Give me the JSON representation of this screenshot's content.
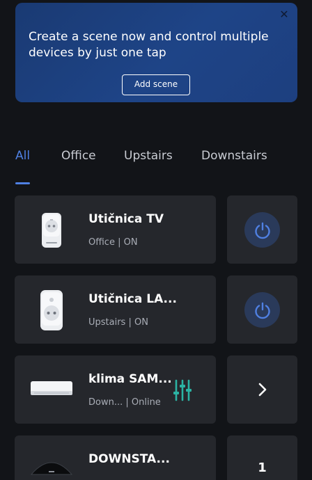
{
  "banner": {
    "text": "Create a scene now and control multiple devices by just one tap",
    "button_label": "Add scene",
    "close_icon": "close-icon"
  },
  "tabs": [
    {
      "label": "All",
      "active": true
    },
    {
      "label": "Office",
      "active": false
    },
    {
      "label": "Upstairs",
      "active": false
    },
    {
      "label": "Downstairs",
      "active": false
    }
  ],
  "devices": [
    {
      "name": "Utičnica TV",
      "status": "Office | ON",
      "icon": "smart-plug-icon",
      "action": "power-button"
    },
    {
      "name": "Utičnica LA...",
      "status": "Upstairs | ON",
      "icon": "smart-plug-icon",
      "action": "power-button"
    },
    {
      "name": "klima SAM...",
      "status": "Down... | Online",
      "icon": "air-conditioner-icon",
      "extra_icon": "sliders-icon",
      "action": "chevron-right-icon"
    },
    {
      "name": "DOWNSTA...",
      "status": "",
      "icon": "ir-hub-icon",
      "action_value": "1"
    }
  ],
  "colors": {
    "accent": "#4f80e2",
    "background": "#121418",
    "card": "#25272c",
    "banner": "#1e4487",
    "power_button": "#2a3a5a",
    "slider_icon": "#2bb3a3"
  }
}
